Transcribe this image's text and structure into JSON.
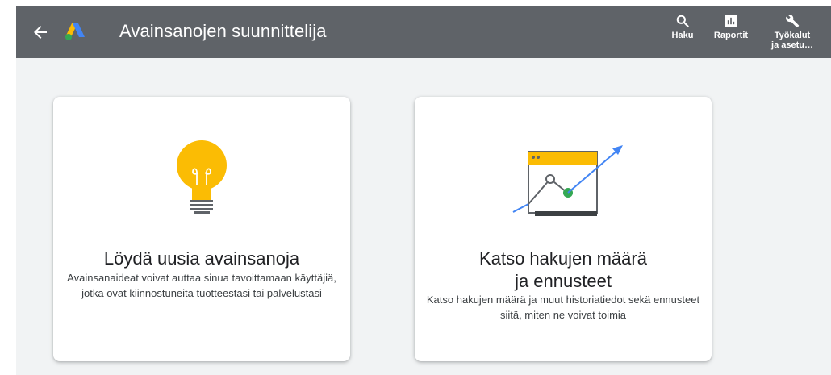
{
  "header": {
    "title": "Avainsanojen suunnittelija",
    "actions": [
      {
        "label": "Haku",
        "icon": "search-icon"
      },
      {
        "label": "Raportit",
        "icon": "reports-icon"
      },
      {
        "label_line1": "Työkalut",
        "label_line2": "ja asetu…",
        "icon": "wrench-icon"
      }
    ]
  },
  "cards": [
    {
      "title": "Löydä uusia avainsanoja",
      "description": "Avainsanaideat voivat auttaa sinua tavoittamaan käyttäjiä, jotka ovat kiinnostuneita tuotteestasi tai palvelustasi",
      "icon": "lightbulb-icon"
    },
    {
      "title": "Katso hakujen määrä ja ennusteet",
      "description": "Katso hakujen määrä ja muut historiatiedot sekä ennusteet siitä, miten ne voivat toimia",
      "icon": "trend-chart-icon"
    }
  ],
  "colors": {
    "topbar": "#5f6368",
    "background": "#f1f3f4",
    "bulb": "#fbbc04",
    "arrow": "#4285f4",
    "green": "#34a853"
  }
}
